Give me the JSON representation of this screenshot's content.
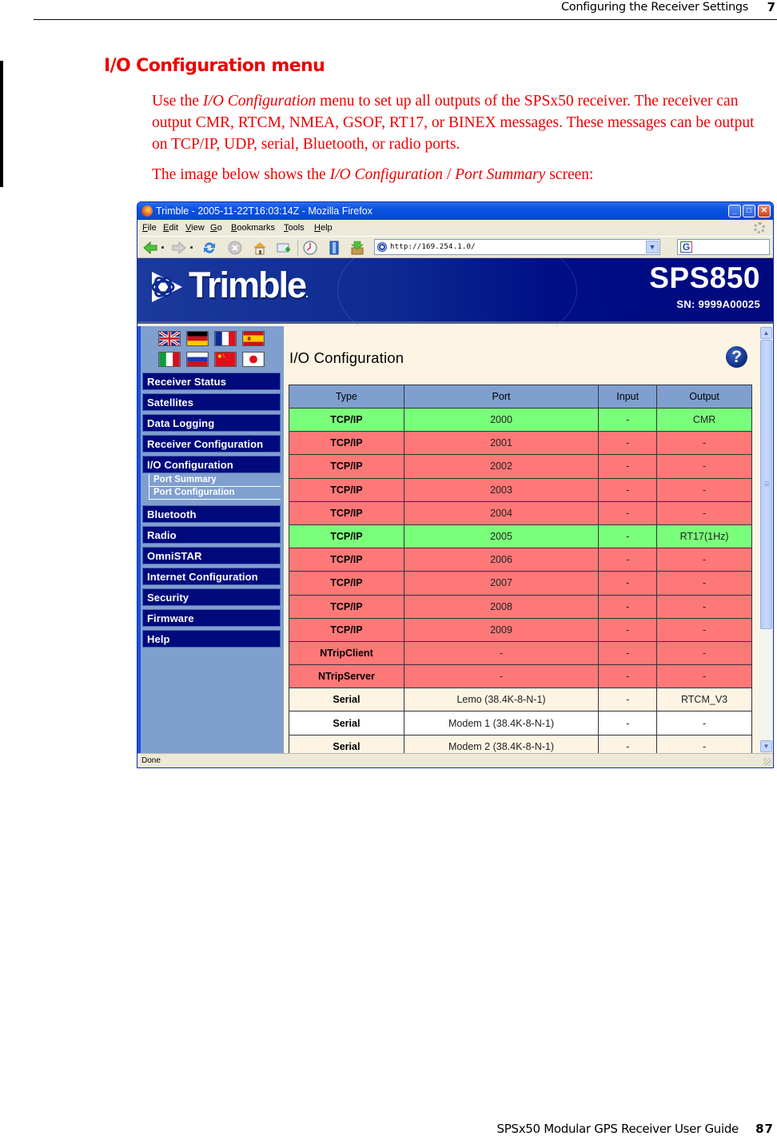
{
  "running_head": {
    "title": "Configuring the Receiver Settings",
    "chapter": "7"
  },
  "section": {
    "title": "I/O Configuration menu",
    "paragraph1": {
      "pre": "Use the ",
      "em": "I/O Configuration",
      "post": " menu to set up all outputs of the SPSx50 receiver. The receiver can output CMR, RTCM, NMEA, GSOF, RT17, or BINEX messages. These messages can be output on TCP/IP, UDP, serial, Bluetooth, or radio ports."
    },
    "paragraph2": {
      "pre": "The image below shows the ",
      "em1": "I/O Configuration",
      "sep": " / ",
      "em2": "Port Summary",
      "post": " screen:"
    }
  },
  "browser": {
    "window_title": "Trimble - 2005-11-22T16:03:14Z - Mozilla Firefox",
    "window_buttons": {
      "minimize": "_",
      "maximize": "□",
      "close": "✕"
    },
    "menu": [
      "File",
      "Edit",
      "View",
      "Go",
      "Bookmarks",
      "Tools",
      "Help"
    ],
    "menu_access_keys": [
      "F",
      "E",
      "V",
      "G",
      "B",
      "T",
      "H"
    ],
    "toolbar_icons": [
      "back-icon",
      "forward-icon",
      "reload-icon",
      "stop-icon",
      "home-icon",
      "new-bookmark-icon",
      "history-icon",
      "bookmarks-icon",
      "download-icon"
    ],
    "url": "http://169.254.1.0/",
    "search_engine_glyph": "G",
    "status": "Done"
  },
  "site": {
    "brand": "Trimble",
    "brand_mark": ".",
    "model": "SPS850",
    "serial": "SN: 9999A00025",
    "languages": [
      "English",
      "German",
      "French",
      "Spanish",
      "Italian",
      "Russian",
      "Chinese",
      "Japanese"
    ],
    "nav": [
      {
        "label": "Receiver Status"
      },
      {
        "label": "Satellites"
      },
      {
        "label": "Data Logging"
      },
      {
        "label": "Receiver Configuration"
      },
      {
        "label": "I/O Configuration",
        "active": true,
        "children": [
          {
            "label": "Port Summary",
            "active": true
          },
          {
            "label": "Port Configuration"
          }
        ]
      },
      {
        "label": "Bluetooth"
      },
      {
        "label": "Radio"
      },
      {
        "label": "OmniSTAR"
      },
      {
        "label": "Internet Configuration"
      },
      {
        "label": "Security"
      },
      {
        "label": "Firmware"
      },
      {
        "label": "Help"
      }
    ],
    "page_title": "I/O Configuration",
    "help_glyph": "?",
    "table": {
      "headers": [
        "Type",
        "Port",
        "Input",
        "Output"
      ],
      "rows": [
        {
          "type": "TCP/IP",
          "port": "2000",
          "input": "-",
          "output": "CMR",
          "state": "on"
        },
        {
          "type": "TCP/IP",
          "port": "2001",
          "input": "-",
          "output": "-",
          "state": "off"
        },
        {
          "type": "TCP/IP",
          "port": "2002",
          "input": "-",
          "output": "-",
          "state": "off"
        },
        {
          "type": "TCP/IP",
          "port": "2003",
          "input": "-",
          "output": "-",
          "state": "off"
        },
        {
          "type": "TCP/IP",
          "port": "2004",
          "input": "-",
          "output": "-",
          "state": "off"
        },
        {
          "type": "TCP/IP",
          "port": "2005",
          "input": "-",
          "output": "RT17(1Hz)",
          "state": "on"
        },
        {
          "type": "TCP/IP",
          "port": "2006",
          "input": "-",
          "output": "-",
          "state": "off"
        },
        {
          "type": "TCP/IP",
          "port": "2007",
          "input": "-",
          "output": "-",
          "state": "off"
        },
        {
          "type": "TCP/IP",
          "port": "2008",
          "input": "-",
          "output": "-",
          "state": "off"
        },
        {
          "type": "TCP/IP",
          "port": "2009",
          "input": "-",
          "output": "-",
          "state": "off"
        },
        {
          "type": "NTripClient",
          "port": "-",
          "input": "-",
          "output": "-",
          "state": "off"
        },
        {
          "type": "NTripServer",
          "port": "-",
          "input": "-",
          "output": "-",
          "state": "off"
        },
        {
          "type": "Serial",
          "port": "Lemo (38.4K-8-N-1)",
          "input": "-",
          "output": "RTCM_V3",
          "state": "neutral"
        },
        {
          "type": "Serial",
          "port": "Modem 1 (38.4K-8-N-1)",
          "input": "-",
          "output": "-",
          "state": "white"
        },
        {
          "type": "Serial",
          "port": "Modem 2 (38.4K-8-N-1)",
          "input": "-",
          "output": "-",
          "state": "neutral"
        }
      ]
    },
    "colors": {
      "enabled_row": "#7aff7a",
      "disabled_row": "#ff7878",
      "nav_bg": "#000a7c",
      "sidebar_bg": "#7f9fcf",
      "content_bg": "#fdf4e3"
    }
  },
  "footer": {
    "guide": "SPSx50 Modular GPS Receiver User Guide",
    "page": "87"
  }
}
